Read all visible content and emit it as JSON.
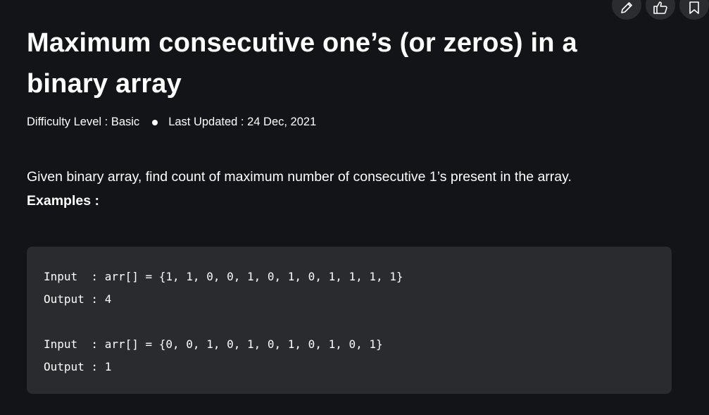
{
  "article": {
    "title": "Maximum consecutive one’s (or zeros) in a binary array",
    "difficulty": "Difficulty Level : Basic",
    "last_updated": "Last Updated : 24 Dec, 2021",
    "description": "Given binary array, find count of maximum number of consecutive 1’s present in the array.",
    "examples_label": "Examples :"
  },
  "code": {
    "lines": [
      "Input  : arr[] = {1, 1, 0, 0, 1, 0, 1, 0, 1, 1, 1, 1}",
      "Output : 4",
      "Input  : arr[] = {0, 0, 1, 0, 1, 0, 1, 0, 1, 0, 1}",
      "Output : 1"
    ]
  },
  "actions": {
    "icons": [
      "pencil-icon",
      "thumbs-up-icon",
      "bookmark-icon"
    ]
  },
  "colors": {
    "background": "#131417",
    "code_background": "#2a2b2e",
    "button_background": "#2b2c30",
    "text": "#ffffff"
  }
}
